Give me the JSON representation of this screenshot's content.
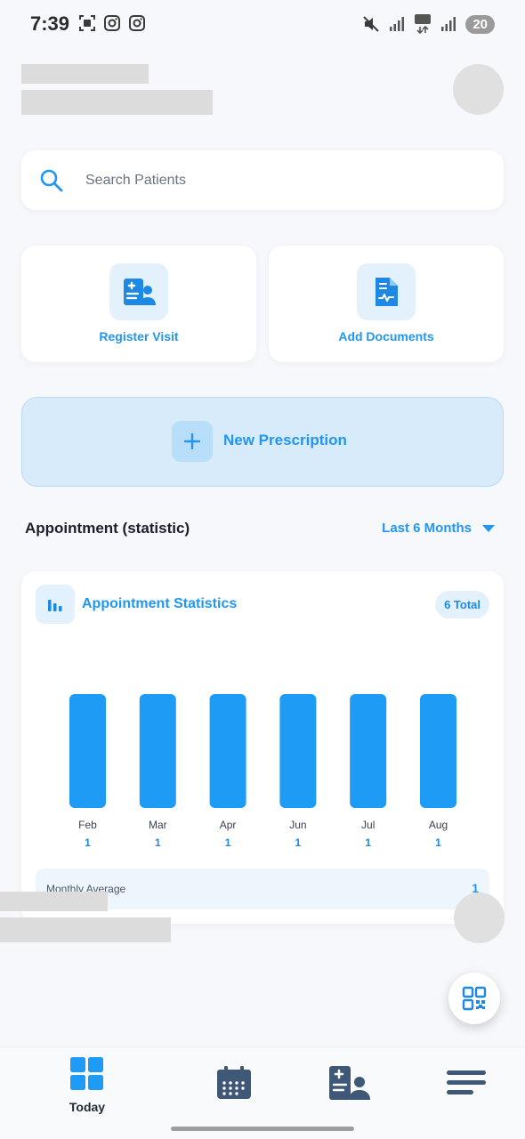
{
  "status_bar": {
    "time": "7:39",
    "battery": "20",
    "left_icons": [
      "screenshot-icon",
      "instagram-icon",
      "instagram-icon"
    ],
    "right_icons": [
      "mute-icon",
      "signal-icon",
      "5g-icon",
      "signal-icon"
    ]
  },
  "search": {
    "placeholder": "Search Patients"
  },
  "actions": [
    {
      "label": "Register Visit",
      "icon": "register-visit-icon"
    },
    {
      "label": "Add Documents",
      "icon": "document-icon"
    }
  ],
  "new_prescription": {
    "label": "New Prescription"
  },
  "appointments": {
    "section_title": "Appointment (statistic)",
    "period": "Last 6 Months"
  },
  "stats_card": {
    "title": "Appointment Statistics",
    "total_badge": "6 Total",
    "monthly_average_label": "Monthly Average",
    "monthly_average_value": "1"
  },
  "chart_data": {
    "type": "bar",
    "categories": [
      "Feb",
      "Mar",
      "Apr",
      "Jun",
      "Jul",
      "Aug"
    ],
    "values": [
      1,
      1,
      1,
      1,
      1,
      1
    ],
    "value_labels": [
      "1",
      "1",
      "1",
      "1",
      "1",
      "1"
    ],
    "title": "Appointment Statistics",
    "xlabel": "",
    "ylabel": "",
    "grid": false,
    "bar_color": "#1e9bf5"
  },
  "bottom_nav": {
    "items": [
      {
        "label": "Today",
        "icon": "dashboard-icon",
        "active": true
      },
      {
        "label": "",
        "icon": "calendar-icon",
        "active": false
      },
      {
        "label": "",
        "icon": "patient-record-icon",
        "active": false
      },
      {
        "label": "",
        "icon": "menu-icon",
        "active": false
      }
    ]
  },
  "colors": {
    "accent": "#2196f3",
    "bar": "#1e9bf5",
    "nav_active": "#1e9bf5",
    "nav_inactive": "#3f5878",
    "background": "#f7f8fb"
  }
}
